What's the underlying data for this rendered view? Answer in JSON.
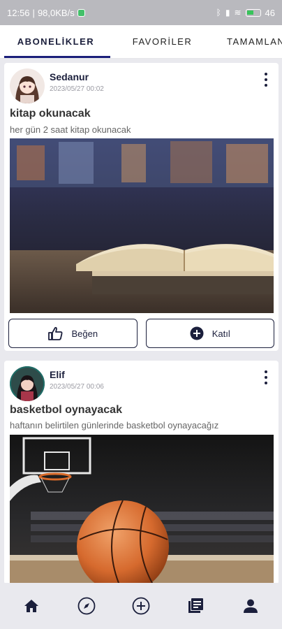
{
  "status_bar": {
    "time": "12:56",
    "net_speed": "98,0KB/s",
    "battery": "46"
  },
  "tabs": [
    {
      "label": "ABONELİKLER",
      "active": true
    },
    {
      "label": "FAVORİLER",
      "active": false
    },
    {
      "label": "TAMAMLAN",
      "active": false
    }
  ],
  "posts": [
    {
      "username": "Sedanur",
      "timestamp": "2023/05/27 00:02",
      "title": "kitap okunacak",
      "description": "her gün 2 saat kitap okunacak",
      "image": "open-book-photo",
      "like_label": "Beğen",
      "join_label": "Katıl"
    },
    {
      "username": "Elif",
      "timestamp": "2023/05/27 00:06",
      "title": "basketbol oynayacak",
      "description": "haftanın belirtilen günlerinde basketbol oynayacağız",
      "image": "basketball-court-photo"
    }
  ],
  "bottom_nav": [
    {
      "icon": "home-icon"
    },
    {
      "icon": "compass-icon"
    },
    {
      "icon": "add-circle-icon"
    },
    {
      "icon": "library-icon",
      "active": true
    },
    {
      "icon": "profile-icon"
    }
  ],
  "colors": {
    "primary": "#1b1f3c",
    "accent": "#1b1f7a",
    "background": "#e9e9ee"
  }
}
